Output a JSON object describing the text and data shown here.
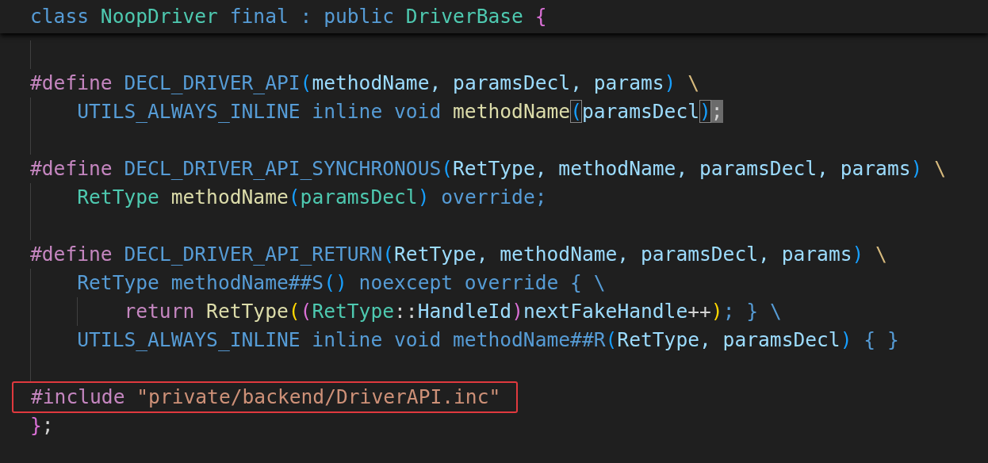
{
  "sticky_header": {
    "tokens": [
      {
        "text": "class ",
        "kind": "kw"
      },
      {
        "text": "NoopDriver",
        "kind": "type"
      },
      {
        "text": " final : public ",
        "kind": "kw"
      },
      {
        "text": "DriverBase ",
        "kind": "type"
      },
      {
        "text": "{",
        "kind": "br2"
      }
    ]
  },
  "lines": [
    {
      "kind": "blank"
    },
    {
      "kind": "code",
      "tokens": [
        {
          "text": "#define",
          "kind": "pp"
        },
        {
          "text": " DECL_DRIVER_API",
          "kind": "macro"
        },
        {
          "text": "(",
          "kind": "br3"
        },
        {
          "text": "methodName, paramsDecl, params",
          "kind": "param"
        },
        {
          "text": ")",
          "kind": "br3"
        },
        {
          "text": " \\",
          "kind": "esc"
        }
      ],
      "children": [
        {
          "kind": "code",
          "tokens": [
            {
              "text": "UTILS_ALWAYS_INLINE inline void ",
              "kind": "macro"
            },
            {
              "text": "methodName",
              "kind": "fn"
            },
            {
              "text": "(",
              "kind": "br3",
              "boxed": true
            },
            {
              "text": "paramsDecl",
              "kind": "param"
            },
            {
              "text": ")",
              "kind": "br3",
              "boxed": true
            },
            {
              "text": ";",
              "kind": "punct",
              "cursor": true
            }
          ]
        }
      ]
    },
    {
      "kind": "blank"
    },
    {
      "kind": "code",
      "tokens": [
        {
          "text": "#define",
          "kind": "pp"
        },
        {
          "text": " DECL_DRIVER_API_SYNCHRONOUS",
          "kind": "macro"
        },
        {
          "text": "(",
          "kind": "br3"
        },
        {
          "text": "RetType, methodName, paramsDecl, params",
          "kind": "param"
        },
        {
          "text": ")",
          "kind": "br3"
        },
        {
          "text": " \\",
          "kind": "esc"
        }
      ],
      "children": [
        {
          "kind": "code",
          "tokens": [
            {
              "text": "RetType ",
              "kind": "type"
            },
            {
              "text": "methodName",
              "kind": "fn"
            },
            {
              "text": "(",
              "kind": "br3"
            },
            {
              "text": "paramsDecl",
              "kind": "type"
            },
            {
              "text": ")",
              "kind": "br3"
            },
            {
              "text": " override;",
              "kind": "macro"
            }
          ]
        }
      ]
    },
    {
      "kind": "blank"
    },
    {
      "kind": "code",
      "tokens": [
        {
          "text": "#define",
          "kind": "pp"
        },
        {
          "text": " DECL_DRIVER_API_RETURN",
          "kind": "macro"
        },
        {
          "text": "(",
          "kind": "br3"
        },
        {
          "text": "RetType, methodName, paramsDecl, params",
          "kind": "param"
        },
        {
          "text": ")",
          "kind": "br3"
        },
        {
          "text": " \\",
          "kind": "esc"
        }
      ],
      "children": [
        {
          "kind": "code",
          "tokens": [
            {
              "text": "RetType methodName##S",
              "kind": "macro"
            },
            {
              "text": "()",
              "kind": "br3"
            },
            {
              "text": " noexcept override { \\",
              "kind": "macro"
            }
          ],
          "children": [
            {
              "kind": "code",
              "tokens": [
                {
                  "text": "return ",
                  "kind": "pp"
                },
                {
                  "text": "RetType",
                  "kind": "fn"
                },
                {
                  "text": "(",
                  "kind": "br1"
                },
                {
                  "text": "(",
                  "kind": "br2"
                },
                {
                  "text": "RetType",
                  "kind": "type"
                },
                {
                  "text": "::",
                  "kind": "punct"
                },
                {
                  "text": "HandleId",
                  "kind": "param"
                },
                {
                  "text": ")",
                  "kind": "br2"
                },
                {
                  "text": "nextFakeHandle",
                  "kind": "param"
                },
                {
                  "text": "++",
                  "kind": "punct"
                },
                {
                  "text": ")",
                  "kind": "br1"
                },
                {
                  "text": "; } \\",
                  "kind": "macro"
                }
              ]
            }
          ]
        },
        {
          "kind": "code",
          "tokens": [
            {
              "text": "UTILS_ALWAYS_INLINE inline void methodName##R",
              "kind": "macro"
            },
            {
              "text": "(",
              "kind": "br3"
            },
            {
              "text": "RetType, paramsDecl",
              "kind": "param"
            },
            {
              "text": ")",
              "kind": "br3"
            },
            {
              "text": " { }",
              "kind": "macro"
            }
          ]
        }
      ]
    },
    {
      "kind": "blank"
    },
    {
      "kind": "code",
      "highlighted": true,
      "tokens": [
        {
          "text": "#include ",
          "kind": "pp"
        },
        {
          "text": "\"private/backend/DriverAPI.inc\"",
          "kind": "str"
        }
      ]
    },
    {
      "kind": "code",
      "tokens": [
        {
          "text": "}",
          "kind": "br2"
        },
        {
          "text": ";",
          "kind": "punct"
        }
      ]
    }
  ]
}
